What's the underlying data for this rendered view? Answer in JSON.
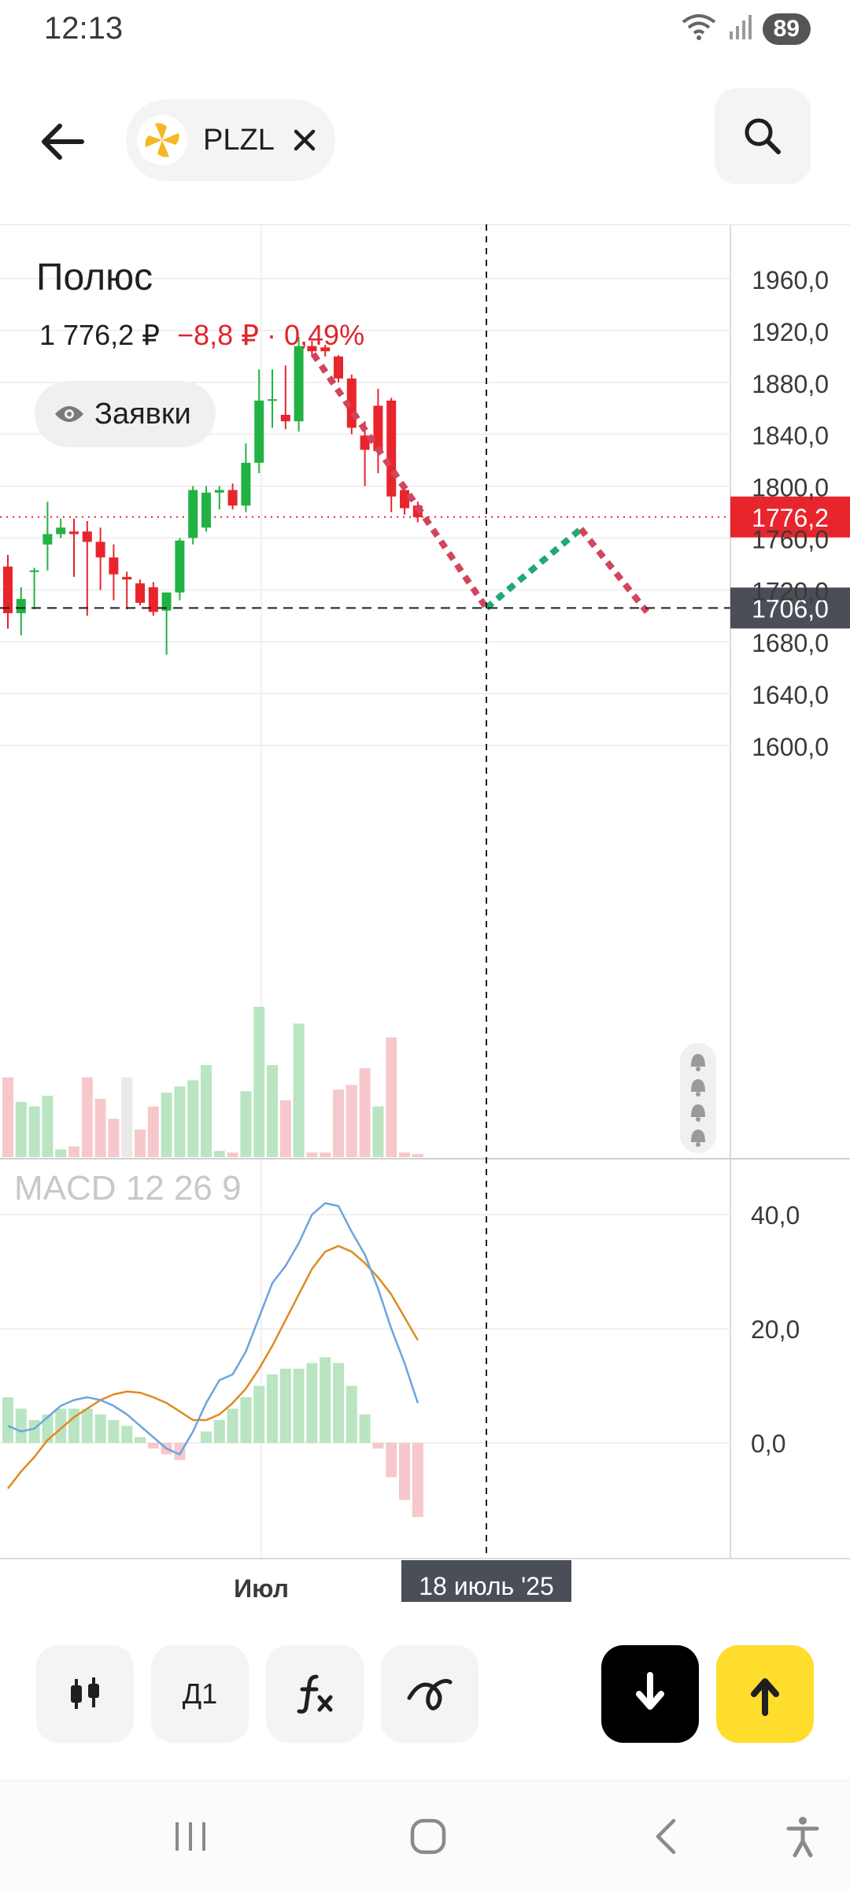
{
  "status": {
    "time": "12:13",
    "battery": "89"
  },
  "header": {
    "ticker": "PLZL"
  },
  "instrument": {
    "name": "Полюс",
    "price": "1 776,2 ₽",
    "change": "−8,8 ₽ · 0,49%",
    "orders_label": "Заявки"
  },
  "price_axis": {
    "ticks": [
      "1960,0",
      "1920,0",
      "1880,0",
      "1840,0",
      "1800,0",
      "1760,0",
      "1720,0",
      "1680,0",
      "1640,0",
      "1600,0"
    ],
    "current_price_label": "1776,2",
    "crosshair_price_label": "1706,0"
  },
  "macd": {
    "label": "MACD 12 26 9",
    "ticks": [
      "40,0",
      "20,0",
      "0,0"
    ]
  },
  "time_axis": {
    "month_label": "Июл",
    "crosshair_date": "18 июль '25"
  },
  "toolbar": {
    "interval_label": "Д1"
  },
  "colors": {
    "up": "#21b243",
    "down": "#e8252d",
    "accent_yellow": "#ffdd2d",
    "macd_line": "#6ea4dc",
    "signal_line": "#e08a20"
  },
  "chart_data": {
    "type": "candlestick",
    "ylim": [
      1590,
      1980
    ],
    "candles": [
      {
        "o": 1738,
        "h": 1747,
        "l": 1690,
        "c": 1702
      },
      {
        "o": 1702,
        "h": 1722,
        "l": 1685,
        "c": 1713
      },
      {
        "o": 1735,
        "h": 1737,
        "l": 1705,
        "c": 1735
      },
      {
        "o": 1755,
        "h": 1788,
        "l": 1735,
        "c": 1763
      },
      {
        "o": 1763,
        "h": 1775,
        "l": 1760,
        "c": 1768
      },
      {
        "o": 1765,
        "h": 1775,
        "l": 1730,
        "c": 1763
      },
      {
        "o": 1765,
        "h": 1773,
        "l": 1700,
        "c": 1757
      },
      {
        "o": 1757,
        "h": 1768,
        "l": 1720,
        "c": 1745
      },
      {
        "o": 1745,
        "h": 1755,
        "l": 1712,
        "c": 1732
      },
      {
        "o": 1730,
        "h": 1734,
        "l": 1705,
        "c": 1728
      },
      {
        "o": 1725,
        "h": 1728,
        "l": 1708,
        "c": 1710
      },
      {
        "o": 1722,
        "h": 1726,
        "l": 1700,
        "c": 1703
      },
      {
        "o": 1704,
        "h": 1718,
        "l": 1670,
        "c": 1718
      },
      {
        "o": 1718,
        "h": 1760,
        "l": 1712,
        "c": 1758
      },
      {
        "o": 1760,
        "h": 1800,
        "l": 1755,
        "c": 1797
      },
      {
        "o": 1768,
        "h": 1800,
        "l": 1765,
        "c": 1795
      },
      {
        "o": 1795,
        "h": 1800,
        "l": 1782,
        "c": 1797
      },
      {
        "o": 1797,
        "h": 1802,
        "l": 1782,
        "c": 1785
      },
      {
        "o": 1785,
        "h": 1833,
        "l": 1780,
        "c": 1818
      },
      {
        "o": 1818,
        "h": 1890,
        "l": 1810,
        "c": 1866
      },
      {
        "o": 1866,
        "h": 1890,
        "l": 1845,
        "c": 1867
      },
      {
        "o": 1855,
        "h": 1893,
        "l": 1844,
        "c": 1850
      },
      {
        "o": 1850,
        "h": 1915,
        "l": 1842,
        "c": 1908
      },
      {
        "o": 1908,
        "h": 1912,
        "l": 1901,
        "c": 1904
      },
      {
        "o": 1907,
        "h": 1909,
        "l": 1900,
        "c": 1904
      },
      {
        "o": 1900,
        "h": 1901,
        "l": 1880,
        "c": 1883
      },
      {
        "o": 1883,
        "h": 1886,
        "l": 1840,
        "c": 1845
      },
      {
        "o": 1839,
        "h": 1850,
        "l": 1800,
        "c": 1828
      },
      {
        "o": 1862,
        "h": 1875,
        "l": 1810,
        "c": 1827
      },
      {
        "o": 1866,
        "h": 1868,
        "l": 1780,
        "c": 1792
      },
      {
        "o": 1797,
        "h": 1800,
        "l": 1778,
        "c": 1783
      },
      {
        "o": 1785,
        "h": 1788,
        "l": 1772,
        "c": 1776
      }
    ],
    "volumes": [
      {
        "v": 0.52,
        "up": false
      },
      {
        "v": 0.36,
        "up": true
      },
      {
        "v": 0.33,
        "up": true
      },
      {
        "v": 0.4,
        "up": true
      },
      {
        "v": 0.05,
        "up": true
      },
      {
        "v": 0.07,
        "up": false
      },
      {
        "v": 0.52,
        "up": false
      },
      {
        "v": 0.38,
        "up": false
      },
      {
        "v": 0.25,
        "up": false
      },
      {
        "v": 0.52,
        "up": null
      },
      {
        "v": 0.18,
        "up": false
      },
      {
        "v": 0.33,
        "up": false
      },
      {
        "v": 0.42,
        "up": true
      },
      {
        "v": 0.46,
        "up": true
      },
      {
        "v": 0.5,
        "up": true
      },
      {
        "v": 0.6,
        "up": true
      },
      {
        "v": 0.04,
        "up": true
      },
      {
        "v": 0.03,
        "up": false
      },
      {
        "v": 0.43,
        "up": true
      },
      {
        "v": 0.98,
        "up": true
      },
      {
        "v": 0.6,
        "up": true
      },
      {
        "v": 0.37,
        "up": false
      },
      {
        "v": 0.87,
        "up": true
      },
      {
        "v": 0.03,
        "up": false
      },
      {
        "v": 0.03,
        "up": false
      },
      {
        "v": 0.44,
        "up": false
      },
      {
        "v": 0.47,
        "up": false
      },
      {
        "v": 0.58,
        "up": false
      },
      {
        "v": 0.33,
        "up": true
      },
      {
        "v": 0.78,
        "up": false
      },
      {
        "v": 0.03,
        "up": false
      },
      {
        "v": 0.02,
        "up": false
      }
    ],
    "macd": {
      "ylim": [
        -20,
        48
      ],
      "histogram": [
        8,
        6,
        4,
        5,
        6,
        6,
        6,
        5,
        4,
        3,
        1,
        -1,
        -2,
        -3,
        0,
        2,
        4,
        6,
        8,
        10,
        12,
        13,
        13,
        14,
        15,
        14,
        10,
        5,
        -1,
        -6,
        -10,
        -13
      ],
      "macd_line": [
        3,
        2,
        2.5,
        4.5,
        6.5,
        7.5,
        8,
        7.5,
        6.5,
        5,
        3,
        1,
        -1,
        -2,
        2,
        7,
        11,
        12,
        16,
        22,
        28,
        31,
        35,
        40,
        42,
        41.5,
        37,
        33,
        27,
        20,
        14,
        7
      ],
      "signal_line": [
        -8,
        -5,
        -2.5,
        0.5,
        2.5,
        4.5,
        6,
        7.5,
        8.5,
        9,
        8.8,
        8,
        7,
        5.5,
        4,
        4,
        5,
        7,
        9.5,
        13,
        17,
        21.5,
        26,
        30.5,
        33.5,
        34.5,
        33.5,
        31.5,
        29,
        26,
        22,
        18
      ]
    },
    "drawing": {
      "segments": [
        {
          "from_price": 1902,
          "to_price": 1706,
          "color": "#d2455c"
        },
        {
          "from_price": 1706,
          "to_price": 1767,
          "color": "#1faa73"
        },
        {
          "from_price": 1767,
          "to_price": 1703,
          "color": "#d2455c"
        }
      ]
    },
    "current_price": 1776.2,
    "crosshair_price": 1706.0
  }
}
